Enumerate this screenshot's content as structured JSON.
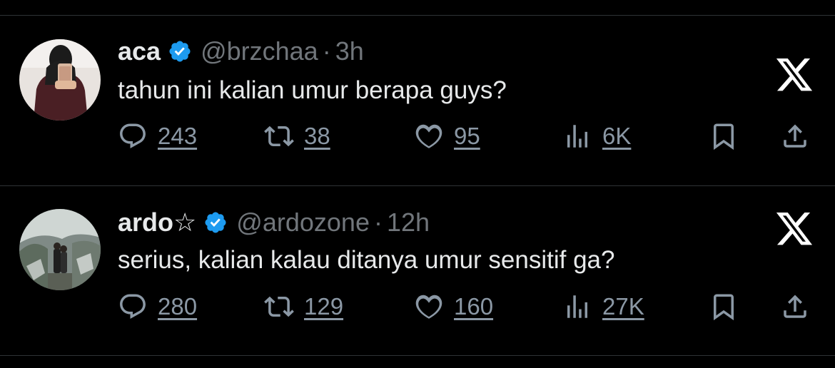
{
  "colors": {
    "background": "#000000",
    "text": "#e7e9ea",
    "muted": "#71767b",
    "verified": "#1d9bf0",
    "divider": "#2f3336"
  },
  "tweets": [
    {
      "name": "aca",
      "handle": "@brzchaa",
      "separator": "·",
      "time": "3h",
      "text": "tahun ini kalian umur berapa guys?",
      "replies": "243",
      "retweets": "38",
      "likes": "95",
      "views": "6K",
      "icons": [
        "avatar",
        "verified-badge-icon",
        "x-logo-icon",
        "reply-icon",
        "retweet-icon",
        "like-icon",
        "views-icon",
        "bookmark-icon",
        "share-icon"
      ]
    },
    {
      "name": "ardo☆",
      "handle": "@ardozone",
      "separator": "·",
      "time": "12h",
      "text": "serius, kalian kalau ditanya umur sensitif ga?",
      "replies": "280",
      "retweets": "129",
      "likes": "160",
      "views": "27K",
      "icons": [
        "avatar",
        "verified-badge-icon",
        "x-logo-icon",
        "reply-icon",
        "retweet-icon",
        "like-icon",
        "views-icon",
        "bookmark-icon",
        "share-icon"
      ]
    }
  ]
}
